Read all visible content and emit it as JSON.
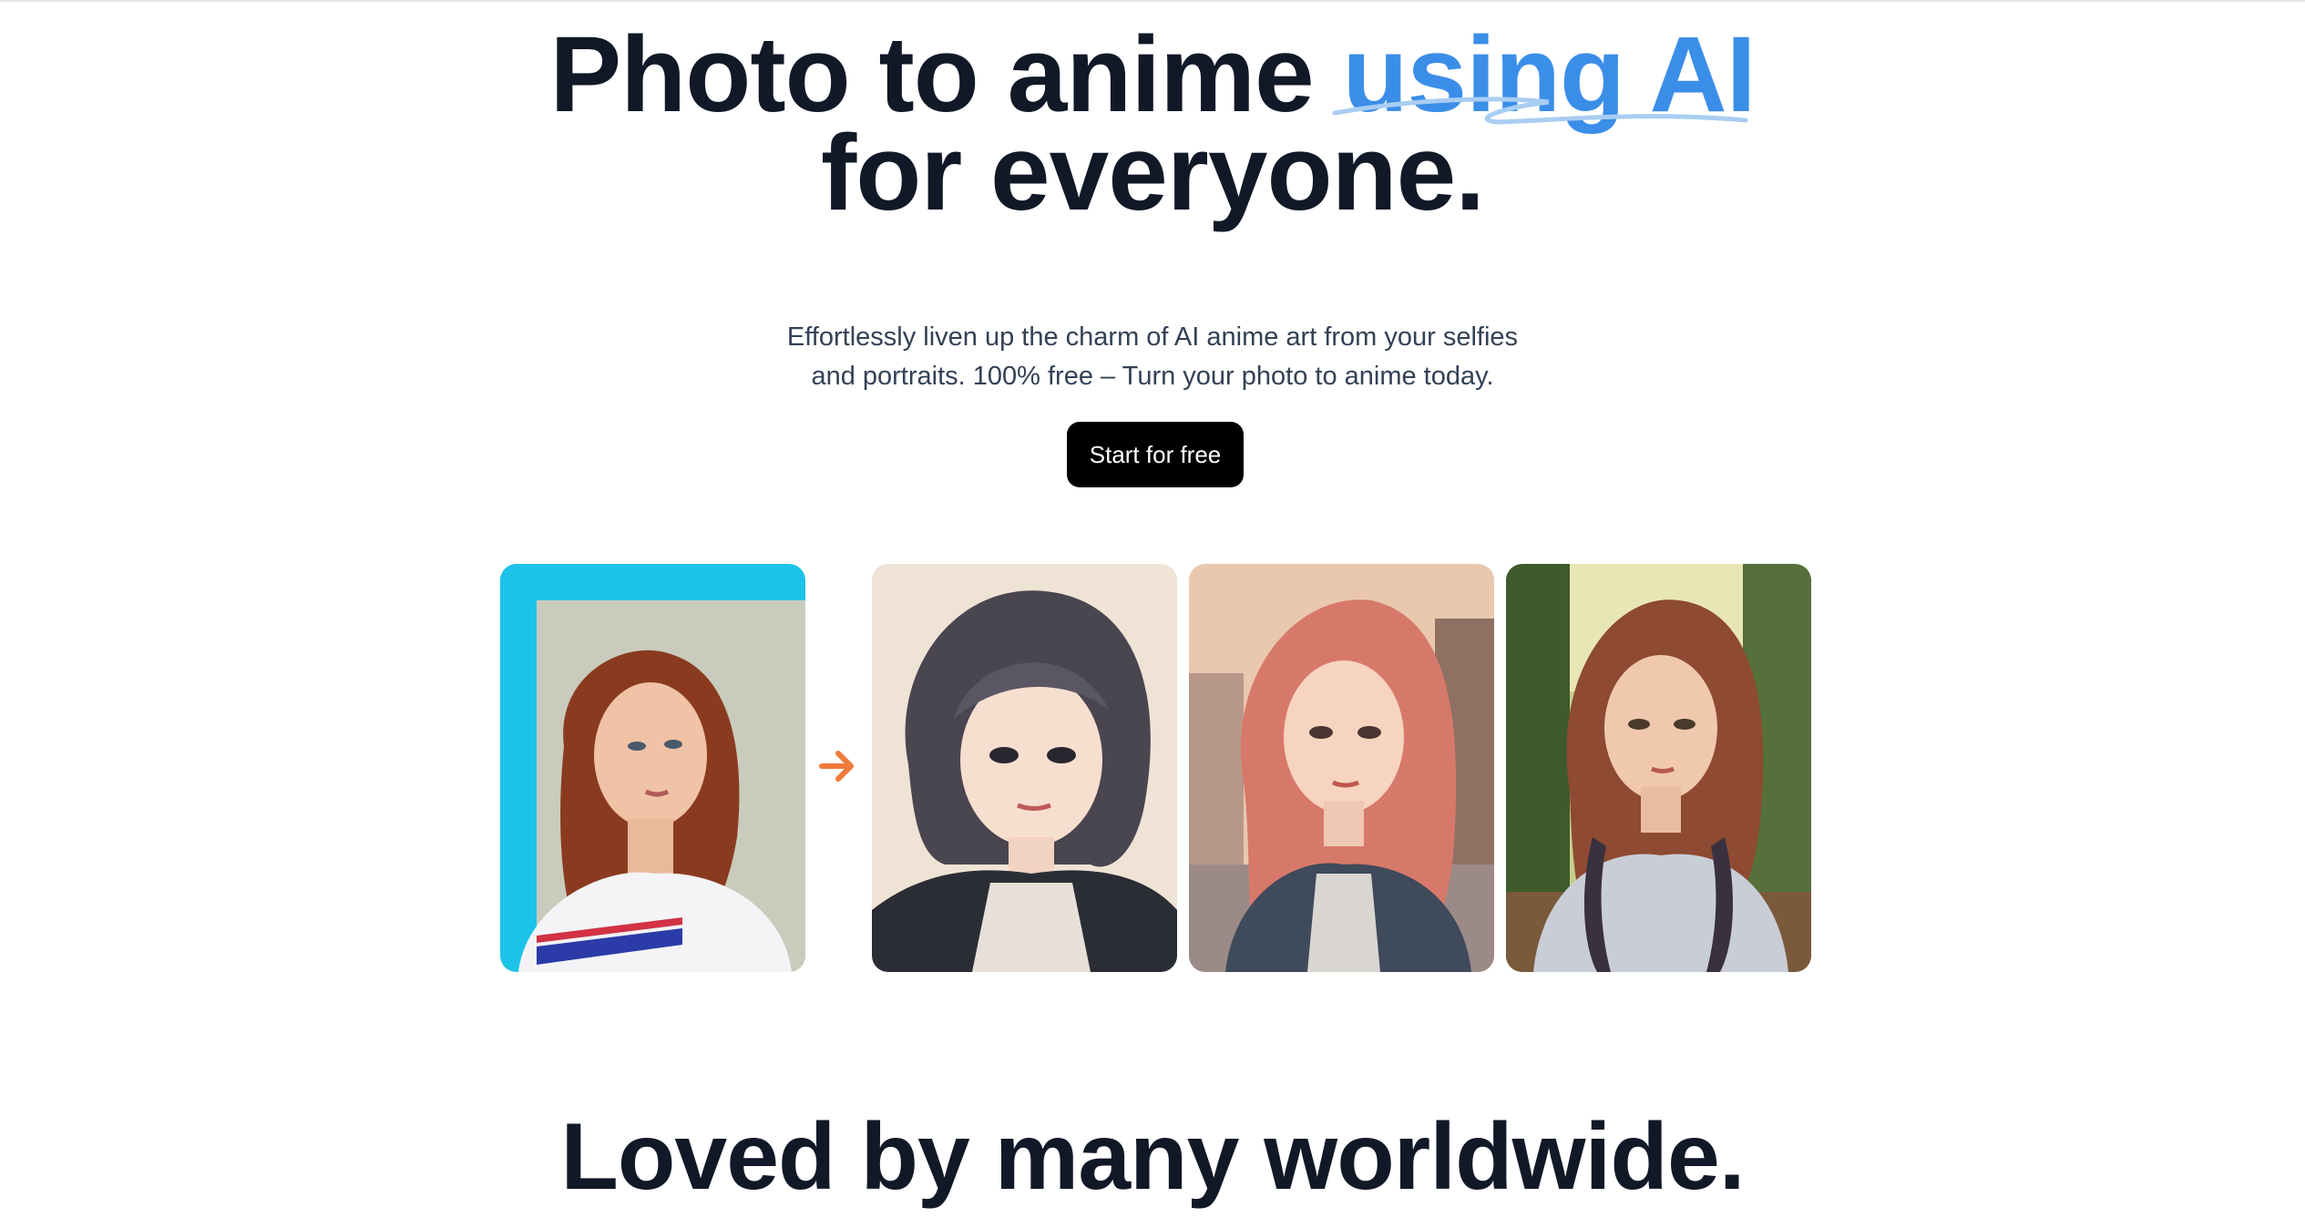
{
  "hero": {
    "title_part1": "Photo to anime ",
    "title_accent": "using AI",
    "title_line2": "for everyone.",
    "subtitle_line1": "Effortlessly liven up the charm of AI anime art from your selfies",
    "subtitle_line2": "and portraits. 100% free – Turn your photo to anime today.",
    "cta_label": "Start for free"
  },
  "gallery": {
    "arrow_icon": "arrow-right-icon",
    "images": [
      {
        "name": "original-photo",
        "kind": "photo"
      },
      {
        "name": "anime-result-1",
        "kind": "anime"
      },
      {
        "name": "anime-result-2",
        "kind": "anime"
      },
      {
        "name": "anime-result-3",
        "kind": "anime"
      }
    ]
  },
  "section": {
    "title": "Loved by many worldwide."
  },
  "colors": {
    "accent": "#3b8ee8",
    "text": "#111827",
    "subtitle": "#334155",
    "button_bg": "#000000",
    "arrow": "#f07a3b"
  }
}
